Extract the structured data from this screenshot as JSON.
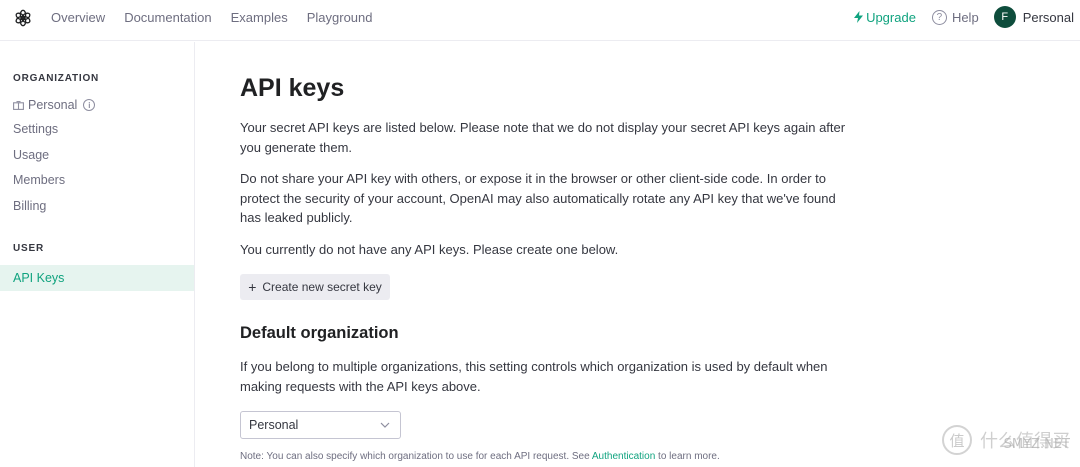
{
  "brand": {
    "logo_icon": "openai-logo-icon"
  },
  "topnav": {
    "items": [
      "Overview",
      "Documentation",
      "Examples",
      "Playground"
    ],
    "upgrade_label": "Upgrade",
    "help_label": "Help",
    "help_icon_glyph": "?",
    "account_initial": "F",
    "account_label": "Personal"
  },
  "sidebar": {
    "org_heading": "ORGANIZATION",
    "org_name": "Personal",
    "org_info_glyph": "i",
    "org_items": [
      "Settings",
      "Usage",
      "Members",
      "Billing"
    ],
    "user_heading": "USER",
    "active_item": "API Keys"
  },
  "main": {
    "title": "API keys",
    "para1": "Your secret API keys are listed below. Please note that we do not display your secret API keys again after you generate them.",
    "para2": "Do not share your API key with others, or expose it in the browser or other client-side code. In order to protect the security of your account, OpenAI may also automatically rotate any API key that we've found has leaked publicly.",
    "para3": "You currently do not have any API keys. Please create one below.",
    "create_button_label": "Create new secret key",
    "create_button_icon": "+",
    "default_org_heading": "Default organization",
    "default_org_desc": "If you belong to multiple organizations, this setting controls which organization is used by default when making requests with the API keys above.",
    "org_select_value": "Personal",
    "note_prefix": "Note: You can also specify which organization to use for each API request. See ",
    "note_link": "Authentication",
    "note_suffix": " to learn more."
  },
  "watermark": {
    "glyph": "值",
    "text": "什么值得买",
    "sub": "SMYZ.NET"
  },
  "colors": {
    "accent": "#10a37f",
    "active_bg": "#e6f4ef",
    "avatar_bg": "#0e4d3c",
    "button_bg": "#ececf1"
  }
}
